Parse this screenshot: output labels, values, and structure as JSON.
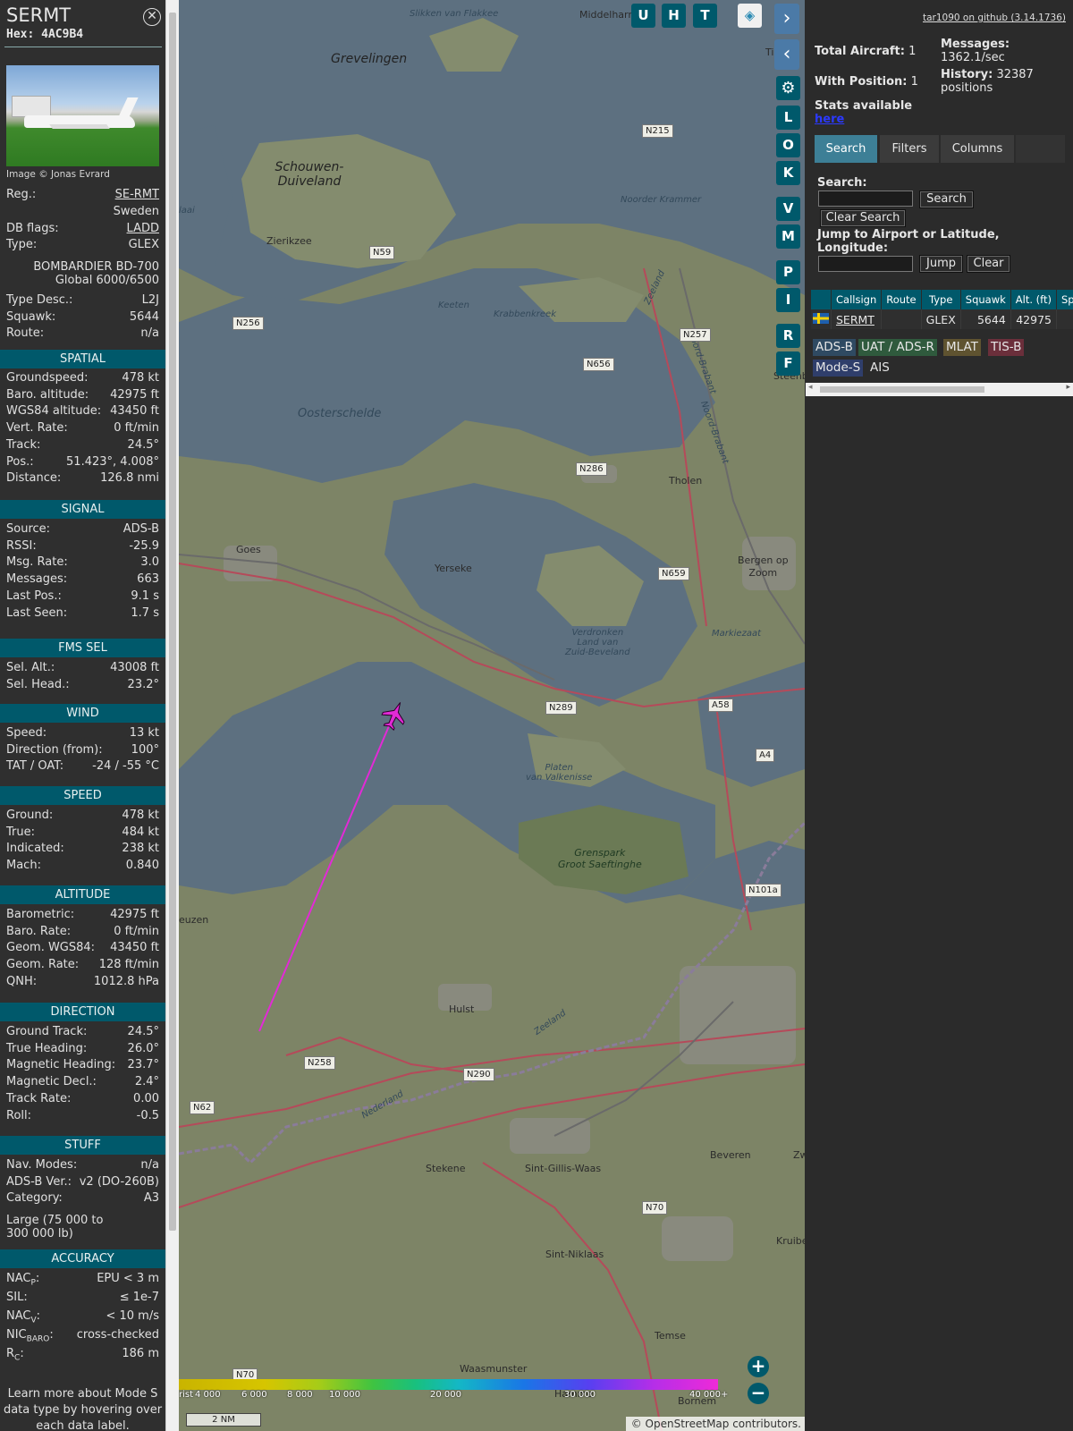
{
  "aircraft": {
    "callsign": "SERMT",
    "hex": "Hex: 4AC9B4",
    "photo_credit": "Image © Jonas Evrard",
    "reg_label": "Reg.:",
    "reg": "SE-RMT",
    "country": "Sweden",
    "dbflags_label": "DB flags:",
    "dbflags": "LADD",
    "type_label": "Type:",
    "type": "GLEX",
    "type_name_1": "BOMBARDIER BD-700",
    "type_name_2": "Global 6000/6500",
    "typedesc_label": "Type Desc.:",
    "typedesc": "L2J",
    "squawk_label": "Squawk:",
    "squawk": "5644",
    "route_label": "Route:",
    "route": "n/a"
  },
  "sections": {
    "spatial": {
      "title": "SPATIAL",
      "rows": [
        {
          "k": "Groundspeed:",
          "v": "478 kt"
        },
        {
          "k": "Baro. altitude:",
          "v": "42975 ft"
        },
        {
          "k": "WGS84 altitude:",
          "v": "43450 ft"
        },
        {
          "k": "Vert. Rate:",
          "v": "0 ft/min"
        },
        {
          "k": "Track:",
          "v": "24.5°"
        },
        {
          "k": "Pos.:",
          "v": "51.423°, 4.008°"
        },
        {
          "k": "Distance:",
          "v": "126.8 nmi"
        }
      ]
    },
    "signal": {
      "title": "SIGNAL",
      "rows": [
        {
          "k": "Source:",
          "v": "ADS-B"
        },
        {
          "k": "RSSI:",
          "v": "-25.9"
        },
        {
          "k": "Msg. Rate:",
          "v": "3.0"
        },
        {
          "k": "Messages:",
          "v": "663"
        },
        {
          "k": "Last Pos.:",
          "v": "9.1 s"
        },
        {
          "k": "Last Seen:",
          "v": "1.7 s"
        }
      ]
    },
    "fms": {
      "title": "FMS SEL",
      "rows": [
        {
          "k": "Sel. Alt.:",
          "v": "43008 ft"
        },
        {
          "k": "Sel. Head.:",
          "v": "23.2°"
        }
      ]
    },
    "wind": {
      "title": "WIND",
      "rows": [
        {
          "k": "Speed:",
          "v": "13 kt"
        },
        {
          "k": "Direction (from):",
          "v": "100°"
        },
        {
          "k": "TAT / OAT:",
          "v": "-24 / -55 °C"
        }
      ]
    },
    "speed": {
      "title": "SPEED",
      "rows": [
        {
          "k": "Ground:",
          "v": "478 kt"
        },
        {
          "k": "True:",
          "v": "484 kt"
        },
        {
          "k": "Indicated:",
          "v": "238 kt"
        },
        {
          "k": "Mach:",
          "v": "0.840"
        }
      ]
    },
    "altitude": {
      "title": "ALTITUDE",
      "rows": [
        {
          "k": "Barometric:",
          "v": "42975 ft"
        },
        {
          "k": "Baro. Rate:",
          "v": "0 ft/min"
        },
        {
          "k": "Geom. WGS84:",
          "v": "43450 ft"
        },
        {
          "k": "Geom. Rate:",
          "v": "128 ft/min"
        },
        {
          "k": "QNH:",
          "v": "1012.8 hPa"
        }
      ]
    },
    "direction": {
      "title": "DIRECTION",
      "rows": [
        {
          "k": "Ground Track:",
          "v": "24.5°"
        },
        {
          "k": "True Heading:",
          "v": "26.0°"
        },
        {
          "k": "Magnetic Heading:",
          "v": "23.7°"
        },
        {
          "k": "Magnetic Decl.:",
          "v": "2.4°"
        },
        {
          "k": "Track Rate:",
          "v": "0.00"
        },
        {
          "k": "Roll:",
          "v": "-0.5"
        }
      ]
    },
    "stuff": {
      "title": "STUFF",
      "rows": [
        {
          "k": "Nav. Modes:",
          "v": "n/a"
        },
        {
          "k": "ADS-B Ver.:",
          "v": "v2 (DO-260B)"
        },
        {
          "k": "Category:",
          "v": "A3"
        }
      ],
      "category_desc_1": "Large (75 000 to",
      "category_desc_2": "300 000 lb)"
    },
    "accuracy": {
      "title": "ACCURACY",
      "rows": [
        {
          "k": "NAC",
          "sub": "P",
          "v": "EPU < 3 m"
        },
        {
          "k": "SIL:",
          "sub": "",
          "v": "≤ 1e-7"
        },
        {
          "k": "NAC",
          "sub": "V",
          "v": "< 10 m/s"
        },
        {
          "k": "NIC",
          "sub": "BARO",
          "v": "cross-checked"
        },
        {
          "k": "R",
          "sub": "C",
          "v": "186 m"
        }
      ]
    },
    "footnote_1": "Learn more about Mode S",
    "footnote_2": "data type by hovering over",
    "footnote_3": "each data label."
  },
  "map": {
    "toolbar": [
      "U",
      "H",
      "T"
    ],
    "side_buttons": [
      "L",
      "O",
      "K",
      "V",
      "M",
      "P",
      "I",
      "R",
      "F"
    ],
    "labels": {
      "middelharnis": "Middelharnis",
      "slikken": "Slikken van Flakkee",
      "grevelingen": "Grevelingen",
      "schouwen": "Schouwen-\nDuiveland",
      "zierikzee": "Zierikzee",
      "oosterschelde": "Oosterschelde",
      "keeten": "Keeten",
      "krabbenkreek": "Krabbenkreek",
      "noorder": "Noorder Krammer",
      "tholen": "Tholen",
      "goes": "Goes",
      "yerseke": "Yerseke",
      "bergen": "Bergen op\nZoom",
      "markiezaat": "Markiezaat",
      "verdronken": "Verdronken\nLand van\nZuid-Beveland",
      "platen": "Platen\nvan Valkenisse",
      "grenspark": "Grenspark\nGroot Saeftinghe",
      "neuzen": "euzen",
      "hulst": "Hulst",
      "sintgillis": "Sint-Gillis-Waas",
      "beveren": "Beveren",
      "stekene": "Stekene",
      "sintniklaas": "Sint-Niklaas",
      "temse": "Temse",
      "waasmunster": "Waasmunster",
      "zeeland": "Zeeland",
      "nederland": "Nederland",
      "noordbrabant": "Noord-Brabant",
      "kruibe": "Kruibe",
      "zw": "Zw",
      "steenb": "Steenb",
      "tie": "Tie",
      "hamme": "Hamme",
      "bornem": "Bornem",
      "taal": "laai"
    },
    "roads": [
      "N215",
      "N59",
      "N256",
      "N656",
      "N257",
      "N286",
      "N659",
      "N289",
      "A58",
      "A4",
      "N101a",
      "N258",
      "N290",
      "N62",
      "N70",
      "N70"
    ],
    "altitude_scale": [
      "4 000",
      "6 000",
      "8 000",
      "10 000",
      "20 000",
      "30 000",
      "40 000+"
    ],
    "altitude_scale_prefix": "rist",
    "scale_text": "2 NM",
    "attribution": "© OpenStreetMap contributors.",
    "zoom_in": "+",
    "zoom_out": "−",
    "track_color": "#e22ad6",
    "aircraft_color": "#e22ad6"
  },
  "panel": {
    "github": "tar1090 on github (3.14.1736)",
    "total_label": "Total Aircraft:",
    "total": "1",
    "withpos_label": "With Position:",
    "withpos": "1",
    "stats_label": "Stats available",
    "stats_link": "here",
    "messages_label": "Messages:",
    "messages": "1362.1/sec",
    "history_label": "History:",
    "history": "32387",
    "history_unit": "positions",
    "tabs": [
      "Search",
      "Filters",
      "Columns"
    ],
    "search_label": "Search:",
    "search_button": "Search",
    "clear_search_button": "Clear Search",
    "jump_label": "Jump to Airport or Latitude, Longitude:",
    "jump_button": "Jump",
    "clear_button": "Clear",
    "table_headers": [
      "",
      "Callsign",
      "Route",
      "Type",
      "Squawk",
      "Alt. (ft)",
      "Spd."
    ],
    "table_rows": [
      {
        "callsign": "SERMT",
        "route": "",
        "type": "GLEX",
        "squawk": "5644",
        "alt": "42975",
        "spd": ""
      }
    ],
    "badges": [
      {
        "label": "ADS-B",
        "bg": "#2f4a62"
      },
      {
        "label": "UAT / ADS-R",
        "bg": "#2f5a3d"
      },
      {
        "label": "MLAT",
        "bg": "#5f5330"
      },
      {
        "label": "TIS-B",
        "bg": "#6b2f3b"
      },
      {
        "label": "Mode-S",
        "bg": "#2f3e6b"
      },
      {
        "label": "AIS",
        "bg": "#2b2b2b"
      }
    ]
  }
}
